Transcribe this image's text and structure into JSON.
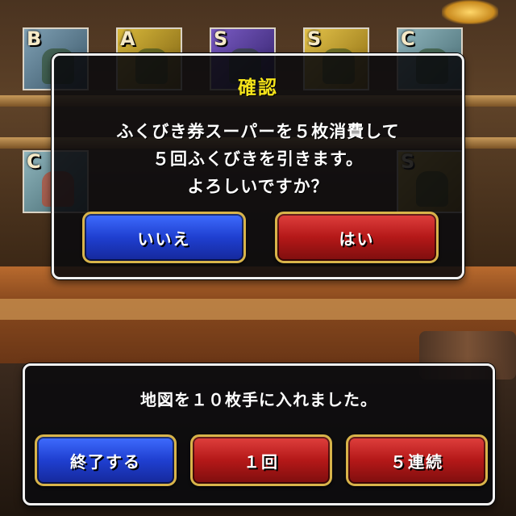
{
  "confirm_dialog": {
    "title": "確認",
    "message_line1": "ふくびき券スーパーを５枚消費して",
    "message_line2": "５回ふくびきを引きます。",
    "message_line3": "よろしいですか？",
    "no_label": "いいえ",
    "yes_label": "はい"
  },
  "result_panel": {
    "message": "地図を１０枚手に入れました。",
    "end_label": "終了する",
    "once_label": "１回",
    "five_times_label": "５連続"
  },
  "prize_cards_row1": [
    {
      "rank": "B"
    },
    {
      "rank": "A"
    },
    {
      "rank": "S"
    },
    {
      "rank": "S"
    },
    {
      "rank": "C"
    }
  ],
  "prize_cards_row2": [
    {
      "rank": "C"
    },
    {
      "rank": "S"
    }
  ],
  "colors": {
    "title_yellow": "#f5e41a",
    "button_blue": "#1f3fd0",
    "button_red": "#b41818",
    "button_border_gold": "#d8b44a"
  }
}
